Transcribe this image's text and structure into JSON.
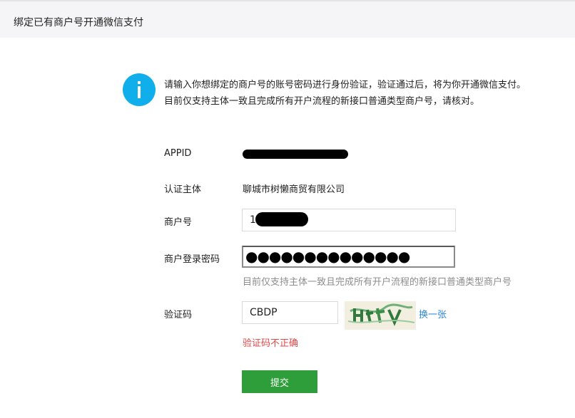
{
  "header": {
    "title": "绑定已有商户号开通微信支付"
  },
  "notice": {
    "icon": "info-icon",
    "line1": "请输入你想绑定的商户号的账号密码进行身份验证，验证通过后，将为你开通微信支付。",
    "line2": "目前仅支持主体一致且完成所有开户流程的新接口普通类型商户号，请核对。"
  },
  "form": {
    "appid": {
      "label": "APPID",
      "value": ""
    },
    "subject": {
      "label": "认证主体",
      "value": "聊城市树懒商贸有限公司"
    },
    "merchant": {
      "label": "商户号",
      "value": "1"
    },
    "password": {
      "label": "商户登录密码",
      "dots": "●●●●●●●●●●●●●●",
      "hint": "目前仅支持主体一致且完成所有开户流程的新接口普通类型商户号"
    },
    "captcha": {
      "label": "验证码",
      "value": "CBDP",
      "refresh_label": "换一张",
      "error": "验证码不正确"
    },
    "submit_label": "提交"
  },
  "colors": {
    "accent_blue": "#10aeea",
    "link": "#2a87d8",
    "error": "#e04848",
    "submit_green": "#2e9e3a"
  }
}
